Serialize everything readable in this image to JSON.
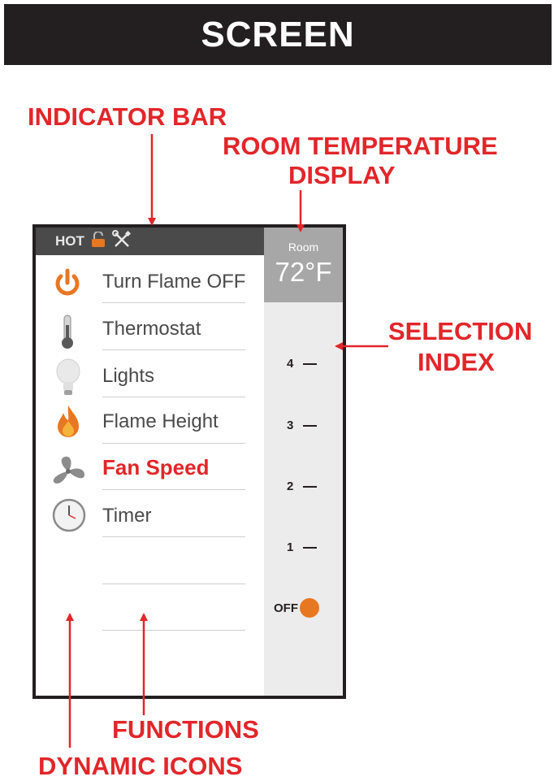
{
  "header": {
    "title": "SCREEN"
  },
  "callouts": {
    "indicator_bar": "INDICATOR BAR",
    "room_temperature_line1": "ROOM TEMPERATURE",
    "room_temperature_line2": "DISPLAY",
    "selection_line1": "SELECTION",
    "selection_line2": "INDEX",
    "functions": "FUNCTIONS",
    "dynamic_icons": "DYNAMIC ICONS"
  },
  "screen": {
    "indicator": {
      "hot_label": "HOT",
      "icons": [
        "unlock-icon",
        "wrench-screwdriver-icon"
      ]
    },
    "room": {
      "label": "Room",
      "temperature": "72°F"
    },
    "menu": [
      {
        "label": "Turn Flame OFF",
        "icon": "power-icon",
        "active": false
      },
      {
        "label": "Thermostat",
        "icon": "thermometer-icon",
        "active": false
      },
      {
        "label": "Lights",
        "icon": "lightbulb-icon",
        "active": false
      },
      {
        "label": "Flame Height",
        "icon": "flame-icon",
        "active": false
      },
      {
        "label": "Fan Speed",
        "icon": "fan-icon",
        "active": true
      },
      {
        "label": "Timer",
        "icon": "clock-icon",
        "active": false
      }
    ],
    "selection_index": {
      "levels": [
        "4",
        "3",
        "2",
        "1"
      ],
      "off_label": "OFF",
      "selected": "OFF"
    }
  },
  "colors": {
    "callout": "#e2262a",
    "accent_orange": "#e87722",
    "header_bg": "#231f20",
    "room_bg": "#a7a7a7"
  }
}
